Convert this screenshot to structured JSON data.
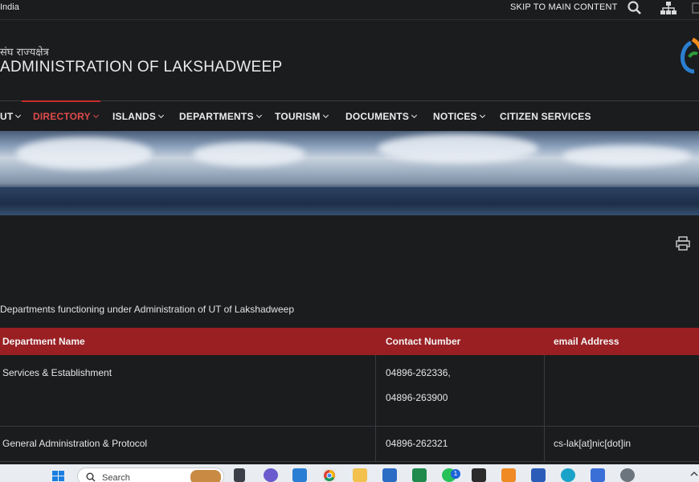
{
  "topbar": {
    "gov_text": "India",
    "skip_label": "SKIP TO MAIN CONTENT"
  },
  "header": {
    "hindi_title": "संघ राज्यक्षेत्र",
    "title": "ADMINISTRATION OF LAKSHADWEEP"
  },
  "nav": {
    "items": [
      {
        "label": "UT"
      },
      {
        "label": "DIRECTORY"
      },
      {
        "label": "ISLANDS"
      },
      {
        "label": "DEPARTMENTS"
      },
      {
        "label": "TOURISM"
      },
      {
        "label": "DOCUMENTS"
      },
      {
        "label": "NOTICES"
      },
      {
        "label": "CITIZEN SERVICES"
      }
    ],
    "active_index": 1
  },
  "main": {
    "intro": "Departments functioning under Administration of UT of Lakshadweep"
  },
  "table": {
    "headers": [
      "Department Name",
      "Contact Number",
      "email Address"
    ],
    "rows": [
      {
        "name": "Services & Establishment",
        "contact_1": "04896-262336,",
        "contact_2": "04896-263900",
        "email": ""
      },
      {
        "name": "General Administration & Protocol",
        "contact_1": "04896-262321",
        "contact_2": "",
        "email": "cs-lak[at]nic[dot]in"
      }
    ]
  },
  "taskbar": {
    "search_placeholder": "Search",
    "badge_count": "1"
  },
  "colors": {
    "accent": "#9a1f23",
    "active_nav": "#e04a4a",
    "background": "#1b1c1e"
  }
}
